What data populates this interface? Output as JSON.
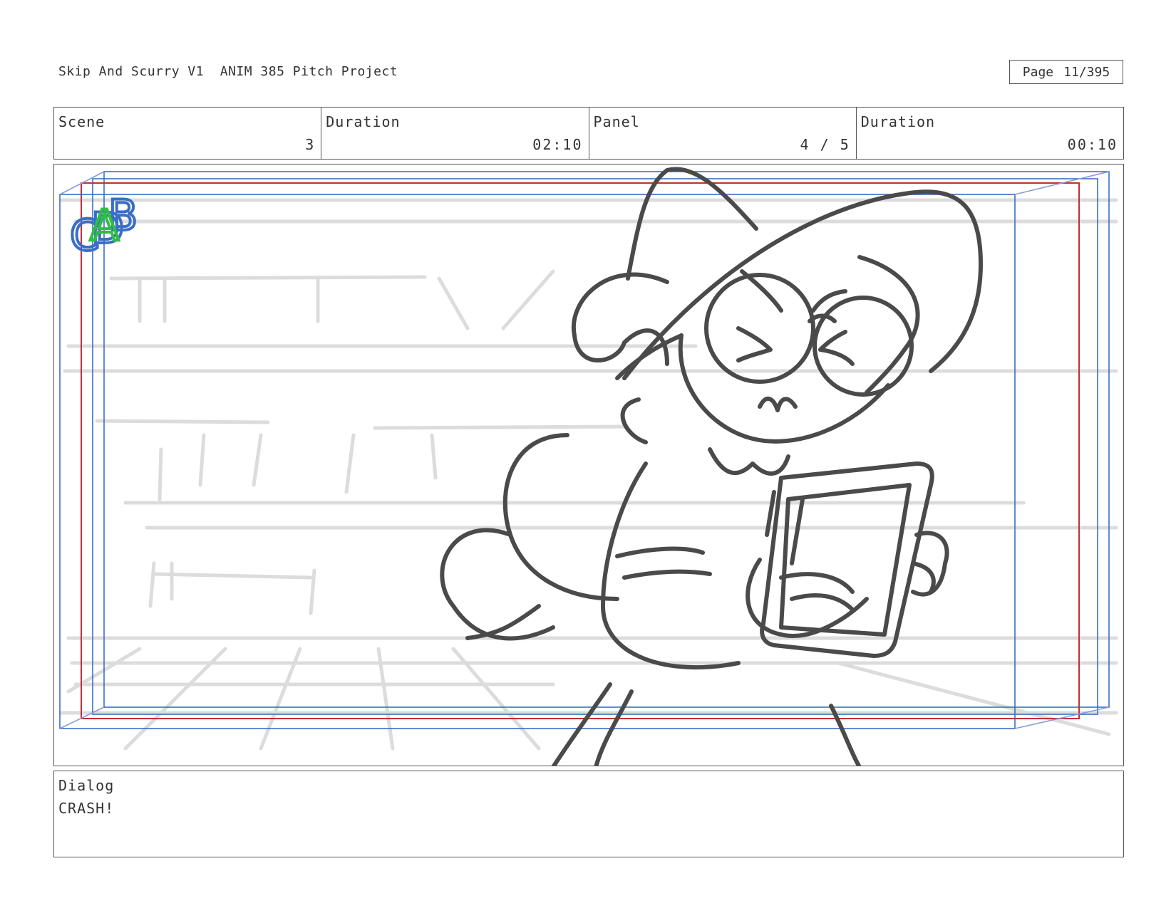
{
  "header": {
    "project_title": "Skip And Scurry V1  ANIM 385 Pitch Project",
    "page_label": "Page",
    "page_value": "11/395"
  },
  "info": {
    "scene_label": "Scene",
    "scene_value": "3",
    "scene_duration_label": "Duration",
    "scene_duration_value": "02:10",
    "panel_label": "Panel",
    "panel_value": "4 / 5",
    "panel_duration_label": "Duration",
    "panel_duration_value": "00:10"
  },
  "panel": {
    "guide_marker_letters": "ABCD",
    "guide_colors": {
      "blue": "#3a6fc4",
      "red": "#c0303a",
      "green": "#2fbf3f",
      "sketch": "#4a4a4a",
      "background_sketch": "#dcdcdc"
    },
    "content": "pencil sketch: character in wide-brim hat with glasses, eyes squeezed shut, clutching a book; shelves in background"
  },
  "dialog": {
    "label": "Dialog",
    "text": "CRASH!"
  }
}
